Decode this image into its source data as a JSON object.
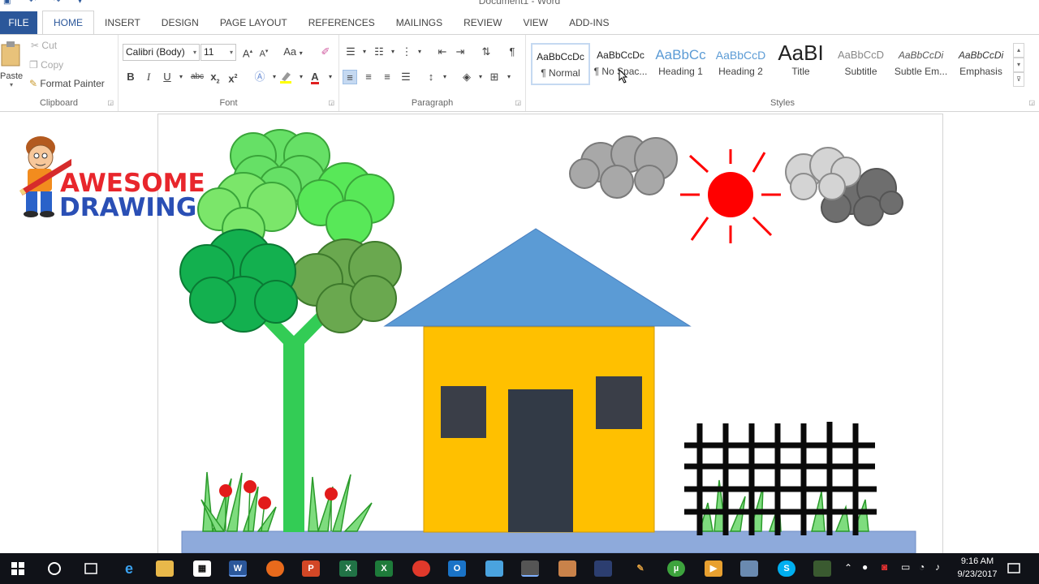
{
  "window": {
    "title": "Document1 - Word"
  },
  "tabs": [
    "FILE",
    "HOME",
    "INSERT",
    "DESIGN",
    "PAGE LAYOUT",
    "REFERENCES",
    "MAILINGS",
    "REVIEW",
    "VIEW",
    "ADD-INS"
  ],
  "active_tab": "HOME",
  "clipboard": {
    "paste": "Paste",
    "cut": "Cut",
    "copy": "Copy",
    "format_painter": "Format Painter",
    "label": "Clipboard"
  },
  "font": {
    "name": "Calibri (Body)",
    "size": "11",
    "label": "Font",
    "grow": "A",
    "shrink": "A",
    "case": "Aa",
    "bold": "B",
    "italic": "I",
    "underline": "U",
    "strike": "abc",
    "subscript": "x",
    "superscript": "x"
  },
  "paragraph": {
    "label": "Paragraph",
    "pilcrow": "¶"
  },
  "styles": {
    "label": "Styles",
    "items": [
      {
        "sample": "AaBbCcDc",
        "name": "¶ Normal"
      },
      {
        "sample": "AaBbCcDc",
        "name": "¶ No Spac..."
      },
      {
        "sample": "AaBbCc",
        "name": "Heading 1"
      },
      {
        "sample": "AaBbCcD",
        "name": "Heading 2"
      },
      {
        "sample": "AaBI",
        "name": "Title"
      },
      {
        "sample": "AaBbCcD",
        "name": "Subtitle"
      },
      {
        "sample": "AaBbCcDi",
        "name": "Subtle Em..."
      },
      {
        "sample": "AaBbCcDi",
        "name": "Emphasis"
      }
    ]
  },
  "logo": {
    "line1": "AWESOME",
    "line2": "DRAWING"
  },
  "clock": {
    "time": "9:16 AM",
    "date": "9/23/2017"
  },
  "colors": {
    "file_tab": "#2b579a",
    "sun": "#ff0000",
    "roof": "#5b9bd5",
    "house": "#ffc000",
    "ground": "#8eaadb",
    "door": "#323a46",
    "trunk": "#33cc55"
  }
}
